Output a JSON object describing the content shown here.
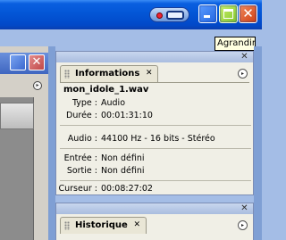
{
  "titlebar": {
    "buttons": [
      "minimize",
      "maximize",
      "close"
    ]
  },
  "tooltip": {
    "text": "Agrandir"
  },
  "panels": {
    "informations": {
      "tab_label": "Informations",
      "filename": "mon_idole_1.wav",
      "fields": [
        {
          "label": "Type :",
          "value": "Audio"
        },
        {
          "label": "Durée :",
          "value": "00:01:31:10"
        },
        {
          "label": "Audio :",
          "value": "44100 Hz - 16 bits - Stéréo"
        },
        {
          "label": "Entrée :",
          "value": "Non défini"
        },
        {
          "label": "Sortie :",
          "value": "Non défini"
        },
        {
          "label": "Curseur :",
          "value": "00:08:27:02"
        }
      ]
    },
    "historique": {
      "tab_label": "Historique"
    }
  },
  "glyphs": {
    "close": "✕",
    "menu": "▸"
  }
}
